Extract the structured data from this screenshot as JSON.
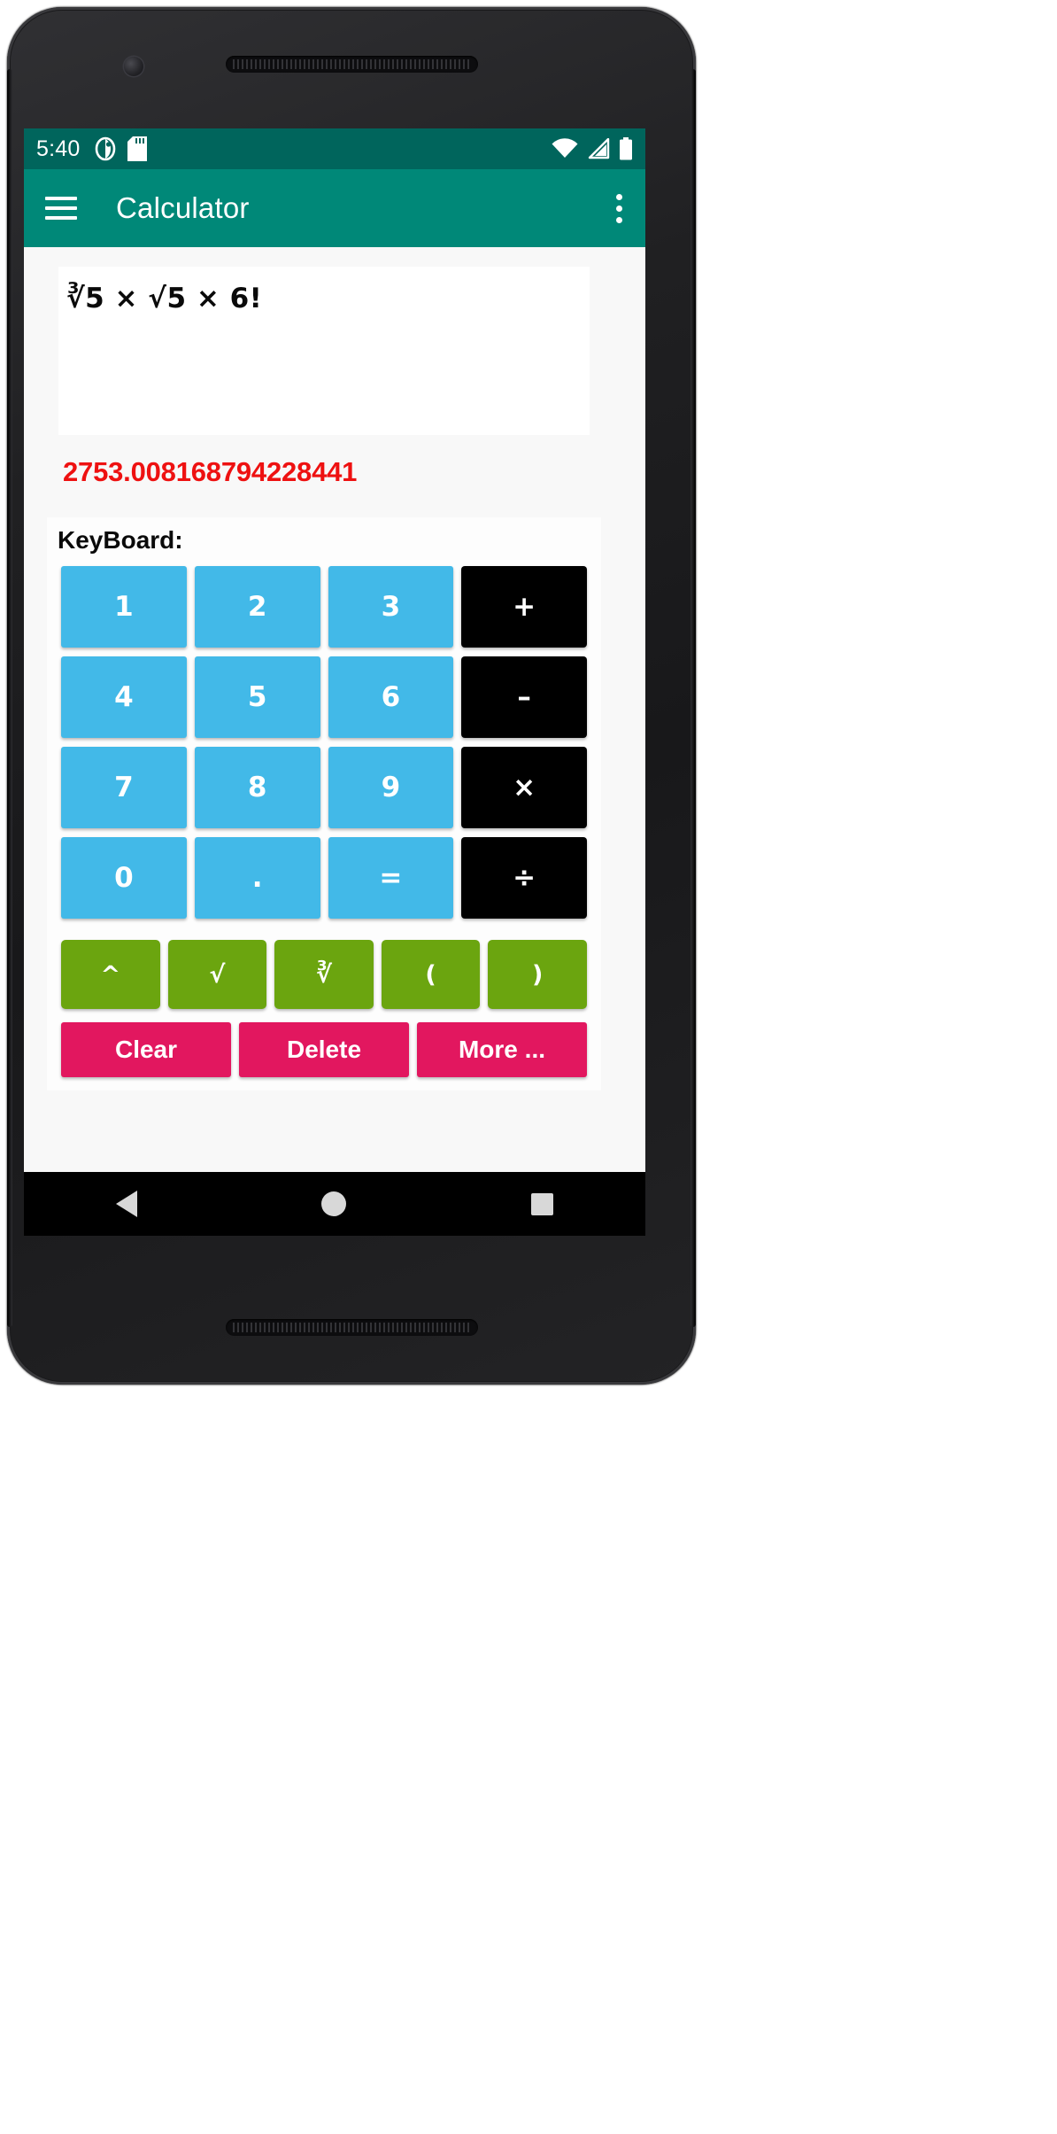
{
  "device": {
    "camera_icon": "front-camera",
    "speaker_icon": "earpiece-speaker"
  },
  "statusbar": {
    "time": "5:40",
    "left_icons": [
      "sim-status-icon",
      "sd-card-icon"
    ],
    "right_icons": [
      "wifi-icon",
      "cell-signal-icon",
      "battery-icon"
    ],
    "background": "#00655c"
  },
  "appbar": {
    "menu_icon": "hamburger-menu-icon",
    "title": "Calculator",
    "overflow_icon": "kebab-overflow-icon",
    "background": "#008878"
  },
  "display": {
    "expression": "∛5 × √5 × 6!",
    "result": "2753.008168794228441",
    "result_color": "#ee1111",
    "expression_color": "#0a0a0a"
  },
  "keyboard": {
    "label": "KeyBoard:",
    "colors": {
      "number": "#42b9e8",
      "operator": "#000000",
      "function": "#6ba50f",
      "action": "#e2175f"
    },
    "main_keys": [
      {
        "label": "1",
        "kind": "num"
      },
      {
        "label": "2",
        "kind": "num"
      },
      {
        "label": "3",
        "kind": "num"
      },
      {
        "label": "+",
        "kind": "op"
      },
      {
        "label": "4",
        "kind": "num"
      },
      {
        "label": "5",
        "kind": "num"
      },
      {
        "label": "6",
        "kind": "num"
      },
      {
        "label": "–",
        "kind": "op"
      },
      {
        "label": "7",
        "kind": "num"
      },
      {
        "label": "8",
        "kind": "num"
      },
      {
        "label": "9",
        "kind": "num"
      },
      {
        "label": "×",
        "kind": "op"
      },
      {
        "label": "0",
        "kind": "num"
      },
      {
        "label": ".",
        "kind": "num"
      },
      {
        "label": "=",
        "kind": "num"
      },
      {
        "label": "÷",
        "kind": "op"
      }
    ],
    "function_keys": [
      {
        "label": "^",
        "name": "power"
      },
      {
        "label": "√",
        "name": "square-root"
      },
      {
        "label": "∛",
        "name": "cube-root"
      },
      {
        "label": "(",
        "name": "open-paren"
      },
      {
        "label": ")",
        "name": "close-paren"
      }
    ],
    "action_keys": [
      {
        "label": "Clear",
        "name": "clear"
      },
      {
        "label": "Delete",
        "name": "delete"
      },
      {
        "label": "More ...",
        "name": "more"
      }
    ]
  },
  "navbar": {
    "back_icon": "nav-back-icon",
    "home_icon": "nav-home-icon",
    "recents_icon": "nav-recents-icon"
  }
}
